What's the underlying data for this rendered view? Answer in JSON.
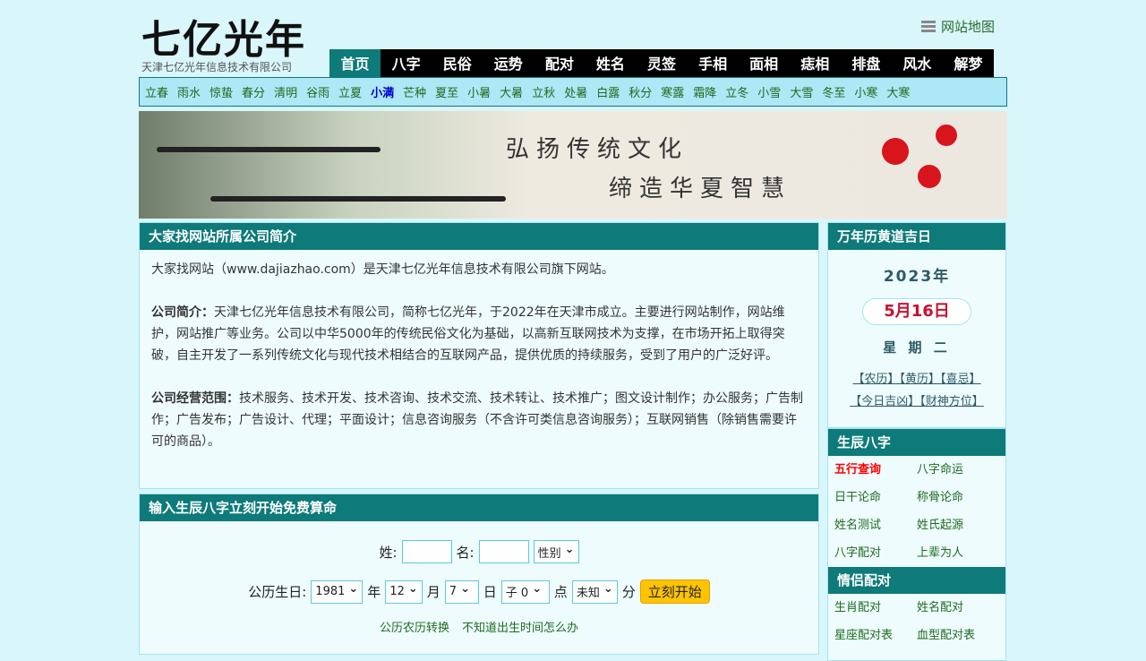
{
  "header": {
    "logo": "七亿光年",
    "company": "天津七亿光年信息技术有限公司",
    "sitemap": "网站地图"
  },
  "nav": [
    "首页",
    "八字",
    "民俗",
    "运势",
    "配对",
    "姓名",
    "灵签",
    "手相",
    "面相",
    "痣相",
    "排盘",
    "风水",
    "解梦"
  ],
  "terms": [
    "立春",
    "雨水",
    "惊蛰",
    "春分",
    "清明",
    "谷雨",
    "立夏",
    "小满",
    "芒种",
    "夏至",
    "小暑",
    "大暑",
    "立秋",
    "处暑",
    "白露",
    "秋分",
    "寒露",
    "霜降",
    "立冬",
    "小雪",
    "大雪",
    "冬至",
    "小寒",
    "大寒"
  ],
  "banner": {
    "line1": "弘扬传统文化",
    "line2": "缔造华夏智慧"
  },
  "intro": {
    "title": "大家找网站所属公司简介",
    "p1": "大家找网站（www.dajiazhao.com）是天津七亿光年信息技术有限公司旗下网站。",
    "p2_label": "公司简介：",
    "p2": "天津七亿光年信息技术有限公司，简称七亿光年，于2022年在天津市成立。主要进行网站制作，网站维护，网站推广等业务。公司以中华5000年的传统民俗文化为基础，以高新互联网技术为支撑，在市场开拓上取得突破，自主开发了一系列传统文化与现代技术相结合的互联网产品，提供优质的持续服务，受到了用户的广泛好评。",
    "p3_label": "公司经营范围：",
    "p3": "技术服务、技术开发、技术咨询、技术交流、技术转让、技术推广；图文设计制作；办公服务；广告制作；广告发布；广告设计、代理；平面设计；信息咨询服务（不含许可类信息咨询服务）；互联网销售（除销售需要许可的商品）。"
  },
  "form": {
    "title": "输入生辰八字立刻开始免费算命",
    "surname": "姓:",
    "name": "名:",
    "gender": "性别",
    "birth": "公历生日:",
    "year": "1981",
    "year_u": "年",
    "month": "12",
    "month_u": "月",
    "day": "7",
    "day_u": "日",
    "hour": "子 0",
    "hour_u": "点",
    "minute": "未知",
    "minute_u": "分",
    "submit": "立刻开始",
    "link1": "公历农历转换",
    "link2": "不知道出生时间怎么办"
  },
  "calendar": {
    "title": "万年历黄道吉日",
    "year": "2023年",
    "date": "5月16日",
    "weekday": "星 期 二",
    "links1": "【农历】【黄历】【喜忌】",
    "links2": "【今日吉凶】【财神方位】"
  },
  "bazi": {
    "title": "生辰八字",
    "items": [
      "五行查询",
      "八字命运",
      "日干论命",
      "称骨论命",
      "姓名测试",
      "姓氏起源",
      "八字配对",
      "上辈为人"
    ]
  },
  "pair": {
    "title": "情侣配对",
    "items": [
      "生肖配对",
      "姓名配对",
      "星座配对表",
      "血型配对表"
    ]
  }
}
